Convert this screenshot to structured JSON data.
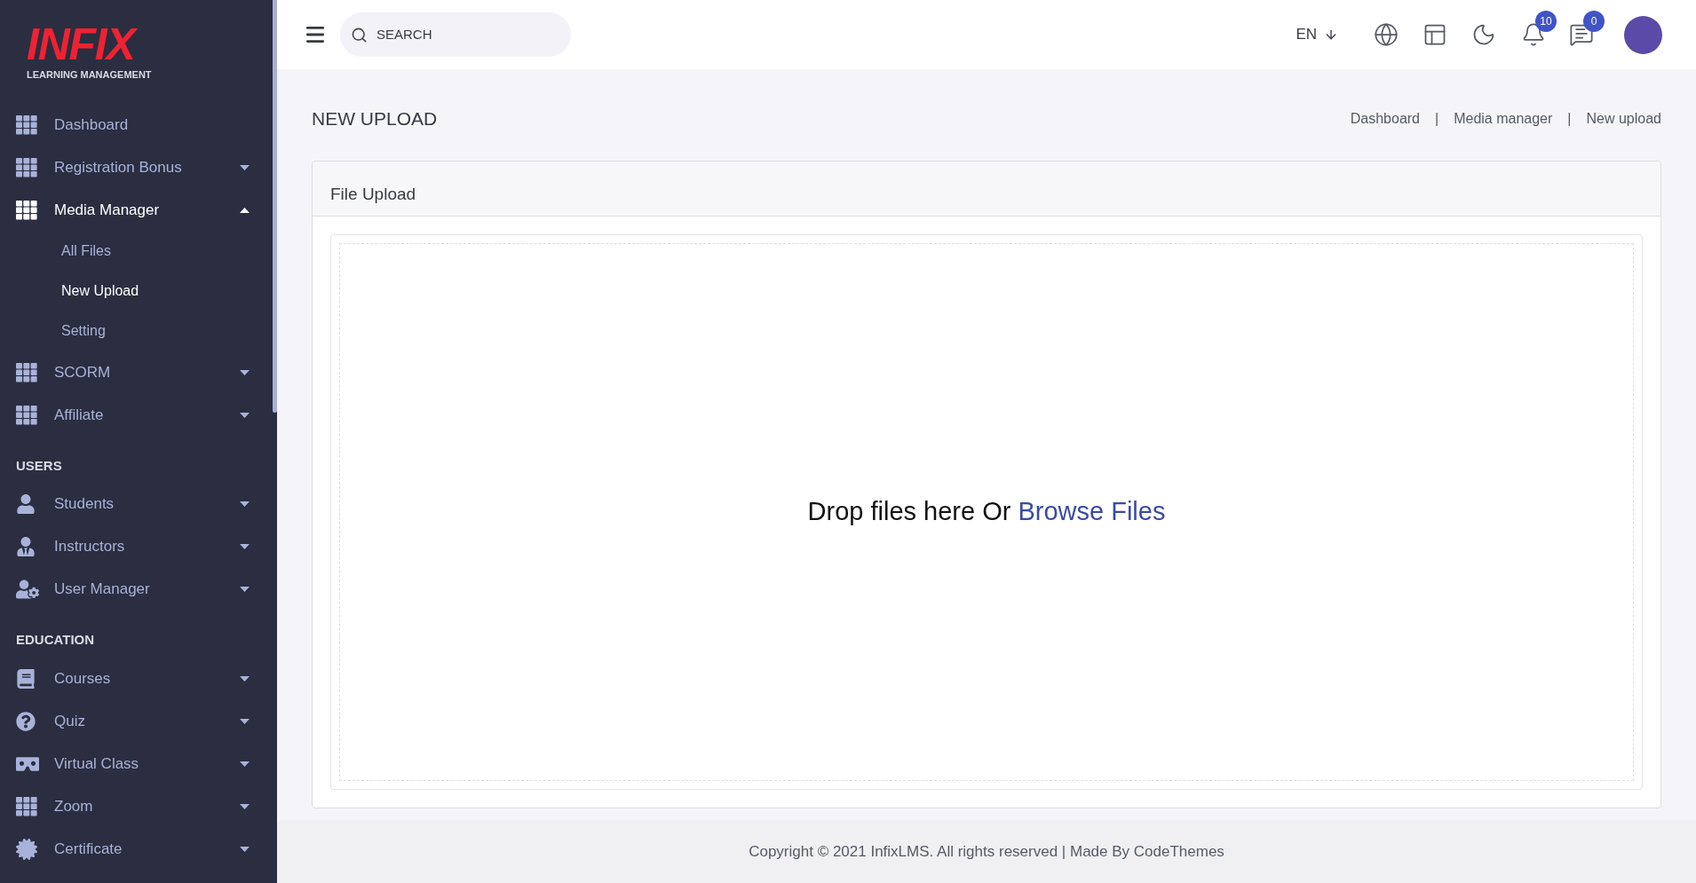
{
  "logo": {
    "name": "INFIX",
    "tagline": "LEARNING MANAGEMENT"
  },
  "sidebar": {
    "sections": [
      {
        "items": [
          {
            "label": "Dashboard",
            "selected": false
          },
          {
            "label": "Registration Bonus",
            "selected": false,
            "expanded": false
          },
          {
            "label": "Media Manager",
            "selected": true,
            "expanded": true,
            "children": [
              {
                "label": "All Files",
                "selected": false
              },
              {
                "label": "New Upload",
                "selected": true
              },
              {
                "label": "Setting",
                "selected": false
              }
            ]
          },
          {
            "label": "SCORM",
            "selected": false,
            "expanded": false
          },
          {
            "label": "Affiliate",
            "selected": false,
            "expanded": false
          }
        ]
      },
      {
        "title": "USERS",
        "items": [
          {
            "label": "Students",
            "selected": false,
            "expanded": false
          },
          {
            "label": "Instructors",
            "selected": false,
            "expanded": false
          },
          {
            "label": "User Manager",
            "selected": false,
            "expanded": false
          }
        ]
      },
      {
        "title": "EDUCATION",
        "items": [
          {
            "label": "Courses",
            "selected": false,
            "expanded": false
          },
          {
            "label": "Quiz",
            "selected": false,
            "expanded": false
          },
          {
            "label": "Virtual Class",
            "selected": false,
            "expanded": false
          },
          {
            "label": "Zoom",
            "selected": false,
            "expanded": false
          },
          {
            "label": "Certificate",
            "selected": false,
            "expanded": false
          }
        ]
      }
    ]
  },
  "topbar": {
    "search": {
      "placeholder": "SEARCH"
    },
    "language": "EN",
    "notifications": "10",
    "messages": "0"
  },
  "page": {
    "title": "NEW UPLOAD",
    "breadcrumb": [
      "Dashboard",
      "Media manager",
      "New upload"
    ],
    "separator": "|"
  },
  "card": {
    "title": "File Upload",
    "dropzone": {
      "text": "Drop files here Or",
      "link": "Browse Files"
    }
  },
  "footer": "Copyright © 2021 InfixLMS. All rights reserved | Made By CodeThemes"
}
